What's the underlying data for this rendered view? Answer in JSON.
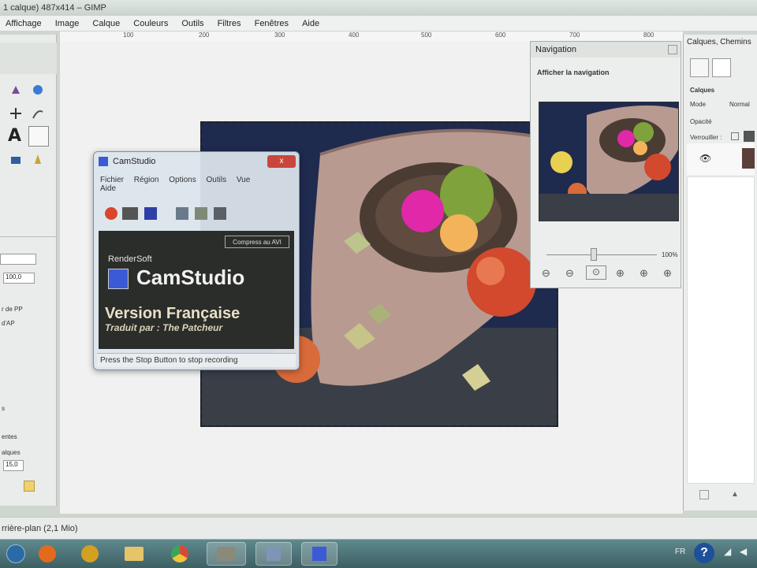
{
  "window": {
    "title": "1 calque) 487x414 – GIMP"
  },
  "menubar": [
    "Affichage",
    "Image",
    "Calque",
    "Couleurs",
    "Outils",
    "Filtres",
    "Fenêtres",
    "Aide"
  ],
  "ruler": {
    "ticks": [
      "100",
      "200",
      "300",
      "400",
      "500",
      "600",
      "700",
      "800"
    ]
  },
  "toolbox": {
    "field1": "100,0",
    "text1": "r de PP",
    "text2": "d'AP",
    "text3": "s",
    "text4": "entes",
    "text5": "alques",
    "field2": "15,0"
  },
  "status": {
    "text": "rrière-plan (2,1 Mio)"
  },
  "camstudio": {
    "title": "CamStudio",
    "close": "x",
    "menu": [
      "Fichier",
      "Région",
      "Options",
      "Outils",
      "Vue",
      "Aide"
    ],
    "compress_label": "Compress au AVI",
    "brand": "RenderSoft",
    "app_name": "CamStudio",
    "version": "Version Française",
    "translator": "Traduit par : The Patcheur",
    "status": "Press the Stop Button to stop recording"
  },
  "navigation": {
    "title": "Navigation",
    "subtitle": "Afficher la navigation",
    "zoom": "100%"
  },
  "layers": {
    "title": "Calques, Chemins",
    "heading": "Calques",
    "mode_label": "Mode",
    "mode_value": "Normal",
    "opacity_label": "Opacité",
    "lock_label": "Verrouiller :"
  },
  "taskbar": {
    "lang": "FR",
    "help": "?"
  },
  "colors": {
    "accent": "#3b5bd6",
    "close_red": "#c9463d",
    "taskbar": "#4b7276"
  }
}
